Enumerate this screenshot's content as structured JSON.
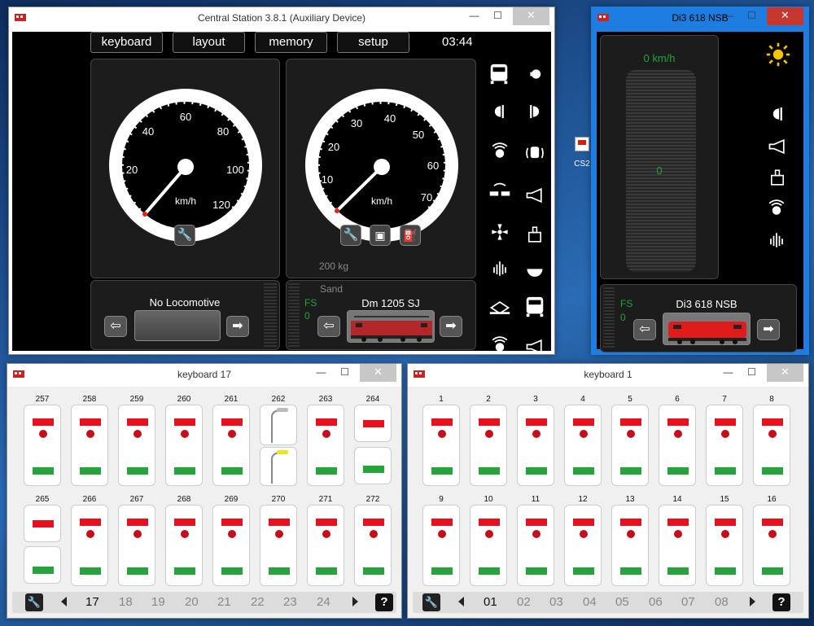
{
  "cs": {
    "title": "Central Station 3.8.1 (Auxiliary Device)",
    "minimize": "—",
    "maximize": "☐",
    "close": "✕",
    "nav": [
      "keyboard",
      "layout",
      "memory",
      "setup"
    ],
    "clock": "03:44"
  },
  "gauge1": {
    "ticks": [
      "20",
      "40",
      "60",
      "80",
      "100",
      "120"
    ],
    "unit": "km/h",
    "bottom_label": "No Locomotive",
    "speed": 0
  },
  "gauge2": {
    "ticks": [
      "10",
      "20",
      "30",
      "40",
      "50",
      "60",
      "70"
    ],
    "unit": "km/h",
    "weight": "200 kg",
    "label1": "Sand",
    "fs": "FS",
    "fs_val": "0",
    "loco": "Dm 1205 SJ",
    "speed": 0
  },
  "di3": {
    "title": "Di3 618 NSB",
    "speed": "0 km/h",
    "value": "0",
    "fs": "FS",
    "fs_val": "0",
    "loco": "Di3 618 NSB",
    "speed_frac": 0
  },
  "desktop_icon": {
    "label": "CS2"
  },
  "kb17": {
    "title": "keyboard 17",
    "nums_top": [
      "257",
      "258",
      "259",
      "260",
      "261",
      "262",
      "263",
      "264"
    ],
    "nums_bot": [
      "265",
      "266",
      "267",
      "268",
      "269",
      "270",
      "271",
      "272"
    ],
    "pages": [
      "17",
      "18",
      "19",
      "20",
      "21",
      "22",
      "23",
      "24"
    ],
    "help": "?"
  },
  "kb1": {
    "title": "keyboard 1",
    "nums_top": [
      "1",
      "2",
      "3",
      "4",
      "5",
      "6",
      "7",
      "8"
    ],
    "nums_bot": [
      "9",
      "10",
      "11",
      "12",
      "13",
      "14",
      "15",
      "16"
    ],
    "pages": [
      "01",
      "02",
      "03",
      "04",
      "05",
      "06",
      "07",
      "08"
    ],
    "help": "?"
  },
  "colors": {
    "red": "#e8101c",
    "green": "#26a33b",
    "fs_green": "#23a33a",
    "di3_frame": "#1e7de0"
  }
}
